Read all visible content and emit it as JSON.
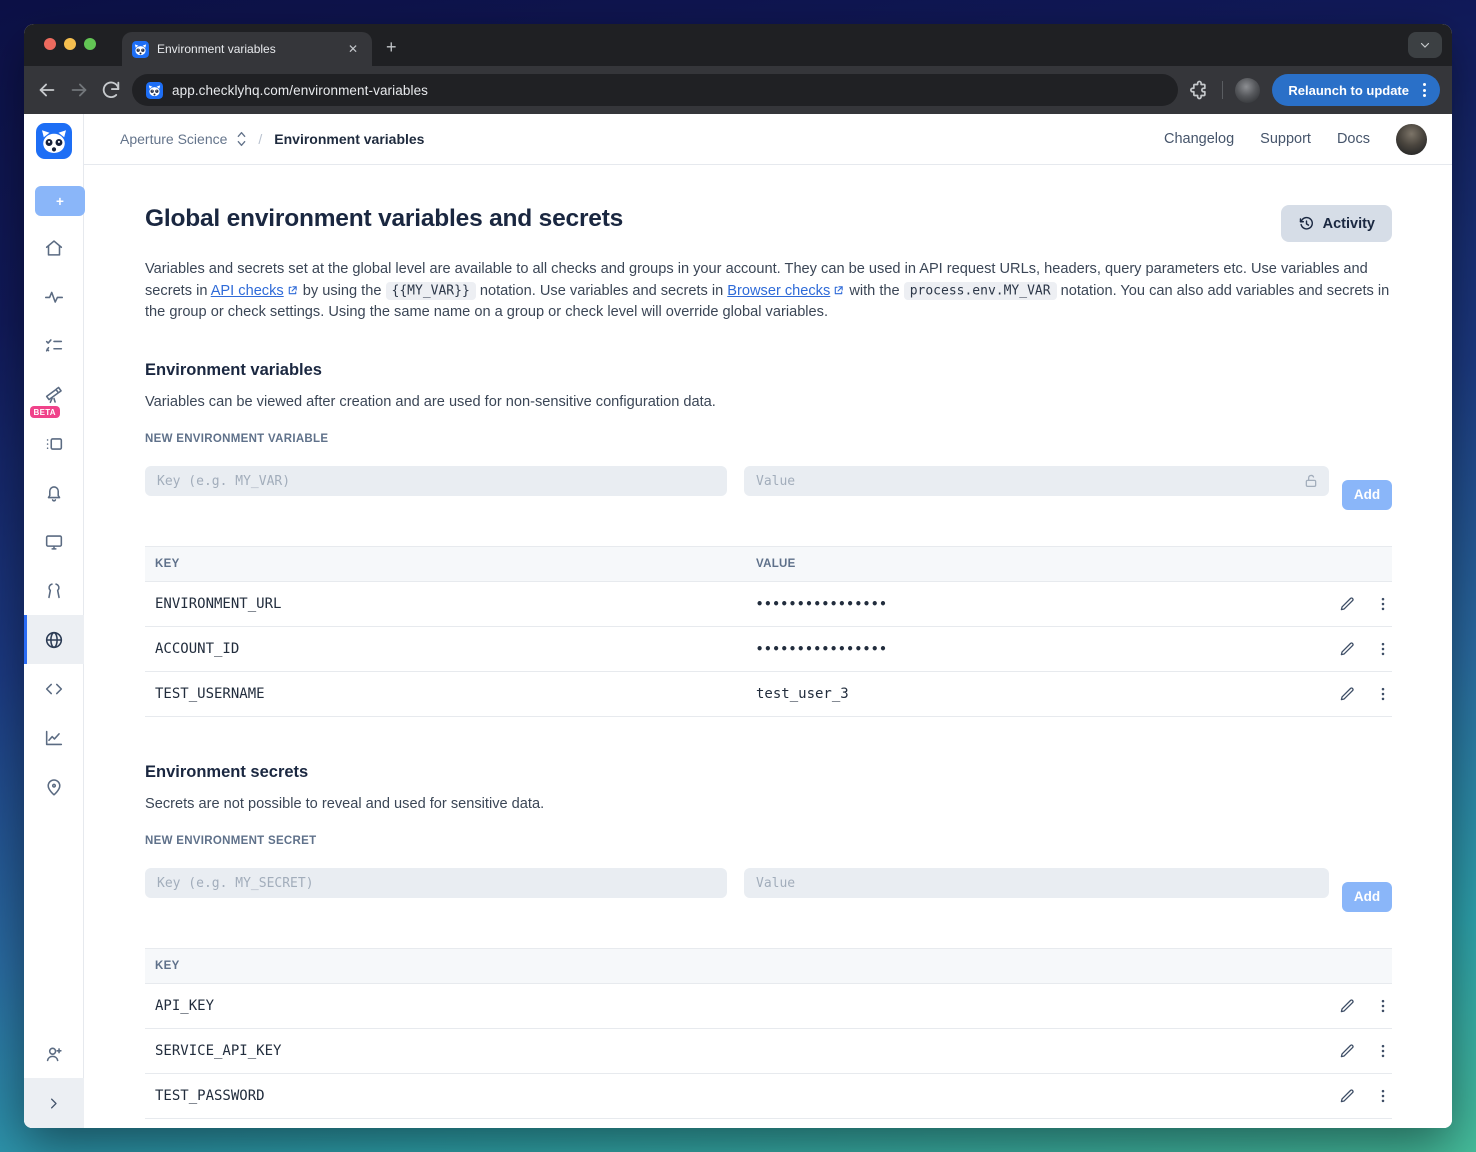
{
  "browser": {
    "tab_title": "Environment variables",
    "new_tab": "+",
    "close_tab": "✕",
    "url": "app.checklyhq.com/environment-variables",
    "relaunch_label": "Relaunch to update"
  },
  "header": {
    "org_name": "Aperture Science",
    "breadcrumb_separator": "/",
    "breadcrumb_current": "Environment variables",
    "links": {
      "changelog": "Changelog",
      "support": "Support",
      "docs": "Docs"
    }
  },
  "sidebar": {
    "beta_badge": "BETA",
    "add_label": "+"
  },
  "page": {
    "title": "Global environment variables and secrets",
    "activity_button": "Activity",
    "intro": {
      "part1": "Variables and secrets set at the global level are available to all checks and groups in your account. They can be used in API request URLs, headers, query parameters etc. Use variables and secrets in ",
      "link_api": "API checks",
      "part2": " by using the ",
      "code1": "{{MY_VAR}}",
      "part3": " notation. Use variables and secrets in ",
      "link_browser": "Browser checks",
      "part4": " with the ",
      "code2": "process.env.MY_VAR",
      "part5": " notation. You can also add variables and secrets in the group or check settings. Using the same name on a group or check level will override global variables."
    }
  },
  "env_vars": {
    "heading": "Environment variables",
    "description": "Variables can be viewed after creation and are used for non-sensitive configuration data.",
    "form_label": "NEW ENVIRONMENT VARIABLE",
    "key_placeholder": "Key (e.g. MY_VAR)",
    "value_placeholder": "Value",
    "add_label": "Add",
    "columns": {
      "key": "KEY",
      "value": "VALUE"
    },
    "rows": [
      {
        "key": "ENVIRONMENT_URL",
        "value": "••••••••••••••••"
      },
      {
        "key": "ACCOUNT_ID",
        "value": "••••••••••••••••"
      },
      {
        "key": "TEST_USERNAME",
        "value": "test_user_3"
      }
    ]
  },
  "env_secrets": {
    "heading": "Environment secrets",
    "description": "Secrets are not possible to reveal and used for sensitive data.",
    "form_label": "NEW ENVIRONMENT SECRET",
    "key_placeholder": "Key (e.g. MY_SECRET)",
    "value_placeholder": "Value",
    "add_label": "Add",
    "columns": {
      "key": "KEY"
    },
    "rows": [
      {
        "key": "API_KEY"
      },
      {
        "key": "SERVICE_API_KEY"
      },
      {
        "key": "TEST_PASSWORD"
      }
    ]
  }
}
